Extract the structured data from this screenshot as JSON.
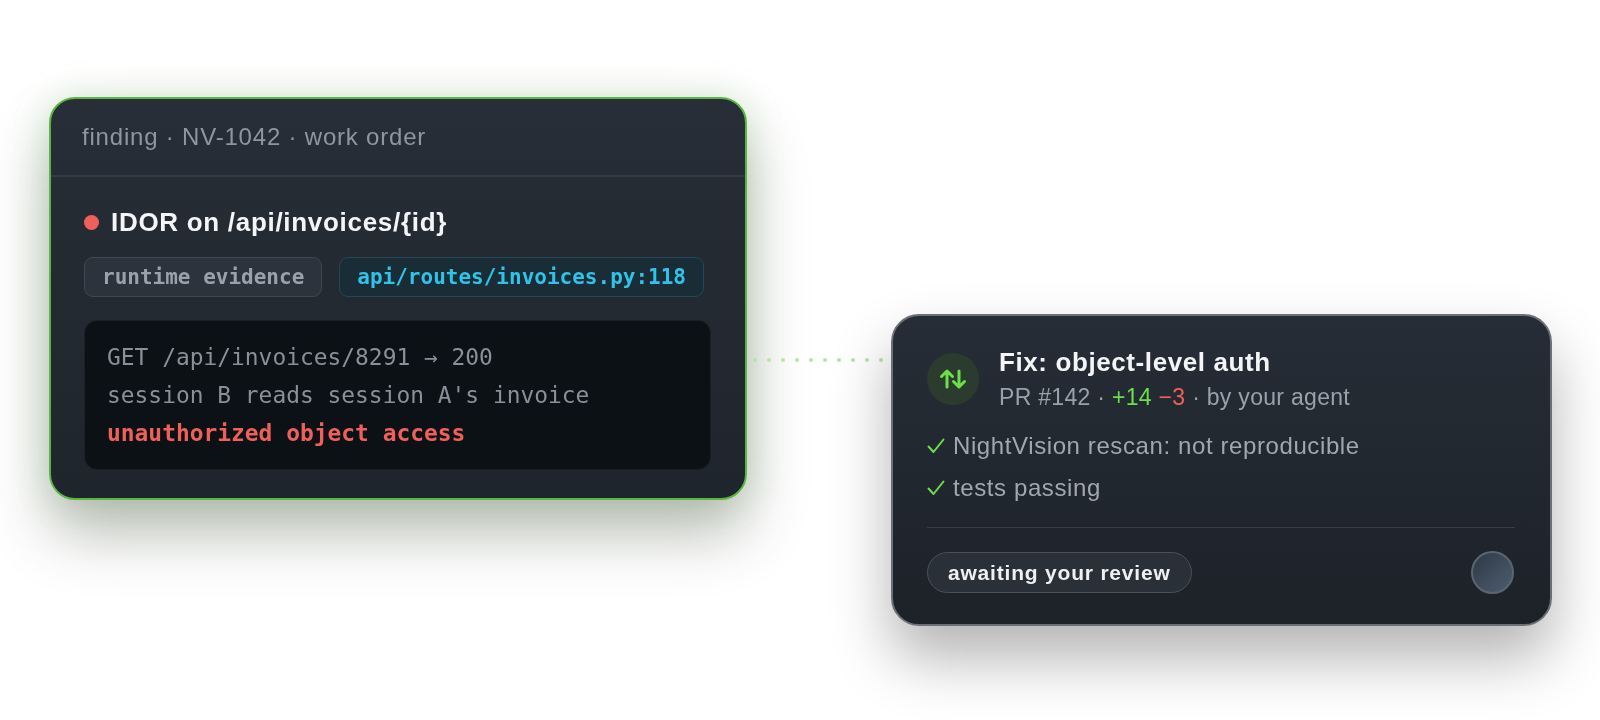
{
  "finding_card": {
    "header": "finding · NV-1042 · work order",
    "title": "IDOR on /api/invoices/{id}",
    "tags": [
      {
        "kind": "label",
        "text": "runtime evidence"
      },
      {
        "kind": "file",
        "text": "api/routes/invoices.py:118"
      }
    ],
    "log_lines": [
      {
        "kind": "plain",
        "text": "GET /api/invoices/8291 → 200"
      },
      {
        "kind": "plain",
        "text": "session B reads session A's invoice"
      },
      {
        "kind": "alert",
        "text": "unauthorized object access"
      }
    ]
  },
  "fix_card": {
    "title": "Fix: object-level auth",
    "summary": [
      {
        "kind": "plain",
        "text": "PR #142 ·"
      },
      {
        "kind": "added",
        "text": "+14"
      },
      {
        "kind": "removed",
        "text": "−3"
      },
      {
        "kind": "plain",
        "text": "· by your agent"
      }
    ],
    "checks": [
      {
        "text": "NightVision rescan: not reproducible",
        "passed": true
      },
      {
        "text": "tests passing",
        "passed": true
      }
    ],
    "status": "awaiting your review"
  }
}
